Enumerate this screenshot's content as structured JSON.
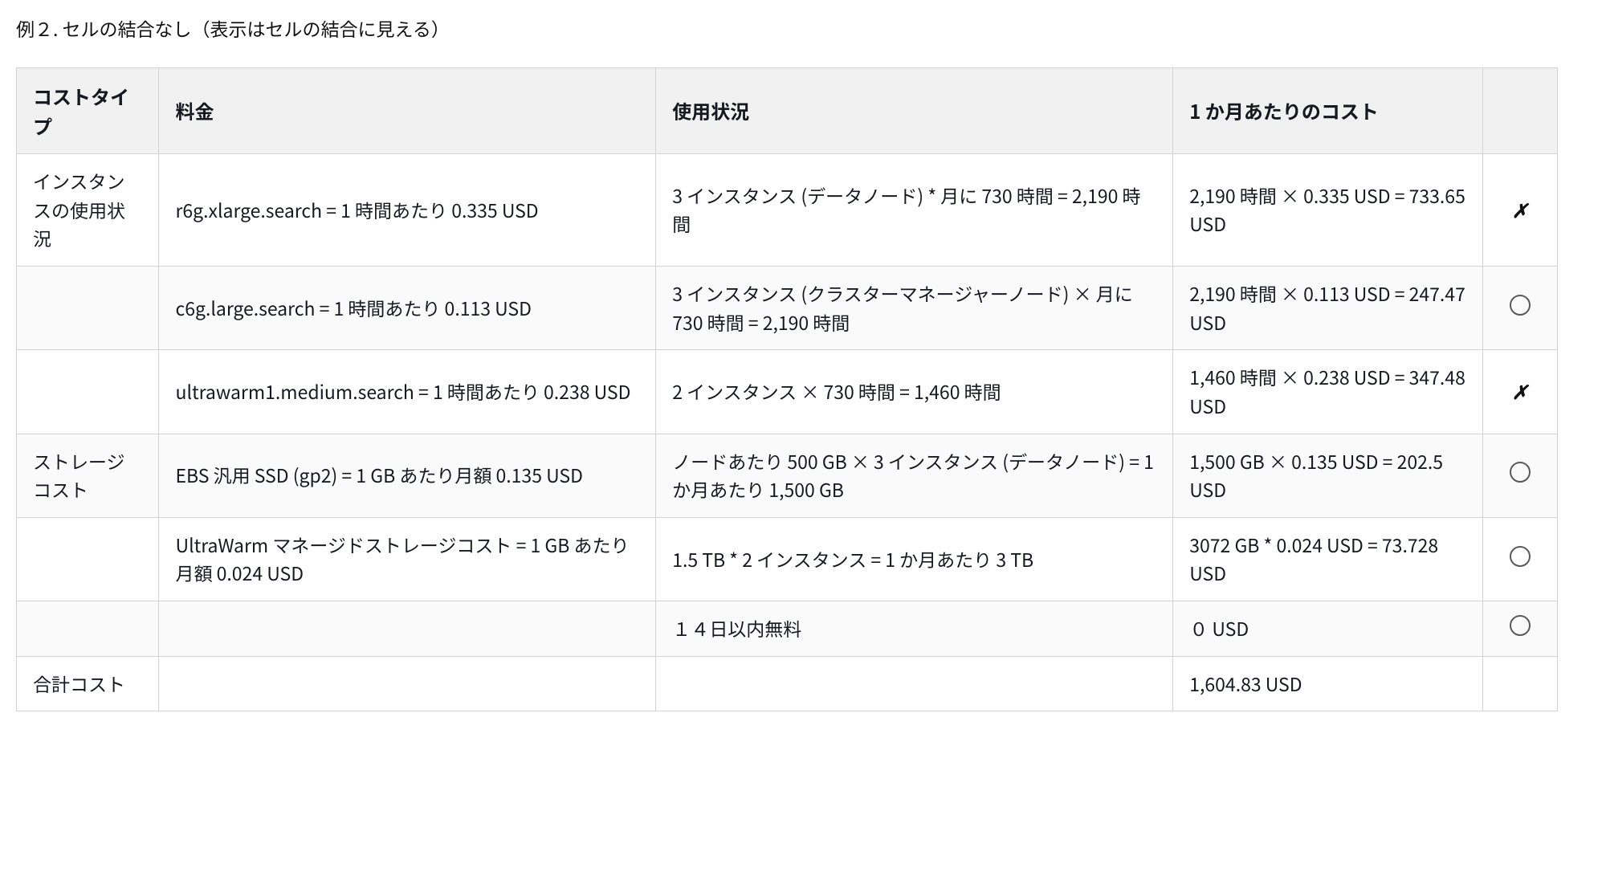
{
  "heading": "例２. セルの結合なし（表示はセルの結合に見える）",
  "headers": {
    "cost_type": "コストタイプ",
    "rate": "料金",
    "usage": "使用状況",
    "per_month": "1 か月あたりのコスト",
    "mark": ""
  },
  "rows": [
    {
      "cost_type": "インスタンスの使用状況",
      "rate": "r6g.xlarge.search = 1 時間あたり 0.335 USD",
      "usage": "3 インスタンス (データノード) * 月に 730 時間 = 2,190 時間",
      "per_month": "2,190 時間 × 0.335 USD = 733.65 USD",
      "mark": "x",
      "alt": false
    },
    {
      "cost_type": "",
      "rate": "c6g.large.search = 1 時間あたり 0.113 USD",
      "usage": "3 インスタンス (クラスターマネージャーノード) × 月に 730 時間 = 2,190 時間",
      "per_month": "2,190 時間 × 0.113 USD = 247.47 USD",
      "mark": "o",
      "alt": true
    },
    {
      "cost_type": "",
      "rate": "ultrawarm1.medium.search = 1 時間あたり 0.238 USD",
      "usage": "2 インスタンス × 730 時間 = 1,460 時間",
      "per_month": "1,460 時間 × 0.238 USD = 347.48 USD",
      "mark": "x",
      "alt": false
    },
    {
      "cost_type": "ストレージコスト",
      "rate": "EBS 汎用 SSD (gp2) = 1 GB あたり月額 0.135 USD",
      "usage": "ノードあたり 500 GB × 3 インスタンス (データノード) = 1 か月あたり 1,500 GB",
      "per_month": "1,500 GB × 0.135 USD = 202.5 USD",
      "mark": "o",
      "alt": true
    },
    {
      "cost_type": "",
      "rate": "UltraWarm マネージドストレージコスト = 1 GB あたり月額 0.024 USD",
      "usage": "1.5 TB * 2 インスタンス = 1 か月あたり 3 TB",
      "per_month": "3072 GB * 0.024 USD = 73.728 USD",
      "mark": "o",
      "alt": false
    },
    {
      "cost_type": "",
      "rate": "",
      "usage": "１４日以内無料",
      "per_month": "０ USD",
      "mark": "o",
      "alt": true
    },
    {
      "cost_type": "合計コスト",
      "rate": "",
      "usage": "",
      "per_month": "1,604.83 USD",
      "mark": "",
      "alt": false
    }
  ]
}
